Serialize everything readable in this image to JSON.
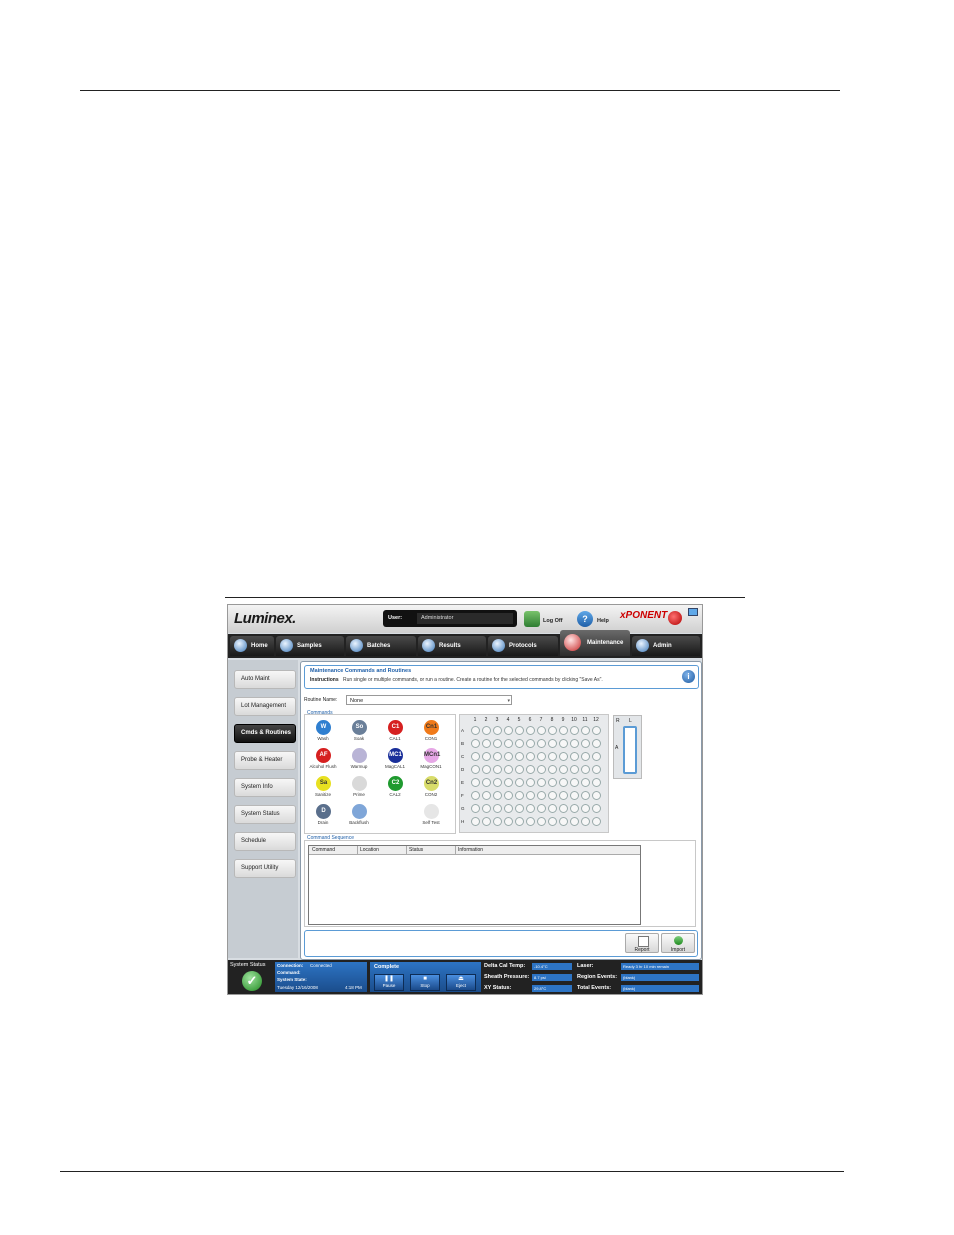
{
  "header": {
    "logo": "Luminex.",
    "user_label": "User:",
    "user_value": "Administrator",
    "logoff_label": "Log Off",
    "help_label": "Help",
    "help_glyph": "?",
    "brand": "xPONENT"
  },
  "nav": {
    "tabs": [
      {
        "label": "Home"
      },
      {
        "label": "Samples"
      },
      {
        "label": "Batches"
      },
      {
        "label": "Results"
      },
      {
        "label": "Protocols"
      },
      {
        "label": "Maintenance",
        "active": true
      },
      {
        "label": "Admin"
      }
    ]
  },
  "sidebar": {
    "items": [
      {
        "label": "Auto Maint"
      },
      {
        "label": "Lot Management"
      },
      {
        "label": "Cmds & Routines",
        "active": true
      },
      {
        "label": "Probe & Heater"
      },
      {
        "label": "System Info"
      },
      {
        "label": "System Status"
      },
      {
        "label": "Schedule"
      },
      {
        "label": "Support Utility"
      }
    ]
  },
  "main": {
    "title": "Maintenance Commands and Routines",
    "instructions_label": "Instructions",
    "instructions_text": "Run single or multiple commands, or run a routine. Create a routine for the selected commands by clicking \"Save As\".",
    "info_glyph": "i",
    "routine_name_label": "Routine Name:",
    "routine_name_value": "None",
    "commands_legend": "Commands",
    "commands": [
      {
        "abbr": "W",
        "label": "Wash",
        "color": "#2f7fd0"
      },
      {
        "abbr": "So",
        "label": "Soak",
        "color": "#6a7f99"
      },
      {
        "abbr": "C1",
        "label": "CAL1",
        "color": "#d62020"
      },
      {
        "abbr": "Cn1",
        "label": "CON1",
        "color": "#f07a1a"
      },
      {
        "abbr": "AF",
        "label": "Alcohol Flush",
        "color": "#d62020"
      },
      {
        "abbr": "",
        "label": "Warmup",
        "color": "#b9b4d6"
      },
      {
        "abbr": "MC1",
        "label": "MagCAL1",
        "color": "#1a2f9a"
      },
      {
        "abbr": "MCn1",
        "label": "MagCON1",
        "color": "#e6a7e6"
      },
      {
        "abbr": "Sa",
        "label": "Sanitize",
        "color": "#e8e020"
      },
      {
        "abbr": "",
        "label": "Prime",
        "color": "#d9d9d9"
      },
      {
        "abbr": "C2",
        "label": "CAL2",
        "color": "#1f9a2f"
      },
      {
        "abbr": "Cn2",
        "label": "CON2",
        "color": "#d8dc6a"
      },
      {
        "abbr": "D",
        "label": "Drain",
        "color": "#5a6f8c"
      },
      {
        "abbr": "",
        "label": "Backflush",
        "color": "#7fa6d8"
      },
      {
        "abbr": "",
        "label": "Self Test",
        "color": "#e6e6e6"
      }
    ],
    "plate_columns": [
      "1",
      "2",
      "3",
      "4",
      "5",
      "6",
      "7",
      "8",
      "9",
      "10",
      "11",
      "12"
    ],
    "plate_rows": [
      "A",
      "B",
      "C",
      "D",
      "E",
      "F",
      "G",
      "H"
    ],
    "reservoir": {
      "col_r": "R",
      "col_l": "L",
      "row_a": "A"
    },
    "sequence_legend": "Command Sequence",
    "sequence_columns": [
      "Command",
      "Location",
      "Status",
      "Information"
    ],
    "report_label": "Report",
    "import_label": "Import"
  },
  "status_bar": {
    "system_status_label": "System Status",
    "check_glyph": "✓",
    "connection_label": "Connection:",
    "connection_value": "Connected",
    "command_label": "Command:",
    "system_state_label": "System State:",
    "date": "Tuesday 12/16/2008",
    "time": "4:18 PM",
    "run_status": "Complete",
    "pause_label": "Pause",
    "stop_label": "Stop",
    "eject_label": "Eject",
    "delta_cal_label": "Delta Cal Temp:",
    "delta_cal_value": "-10.4°C",
    "sheath_label": "Sheath Pressure:",
    "sheath_value": "8.7 psi",
    "xy_label": "XY Status:",
    "xy_value": "29.8°C",
    "laser_label": "Laser:",
    "laser_value": "Ready 3 hr 10 min remain",
    "region_label": "Region Events:",
    "region_value": "(blank)",
    "total_label": "Total Events:",
    "total_value": "(blank)"
  }
}
